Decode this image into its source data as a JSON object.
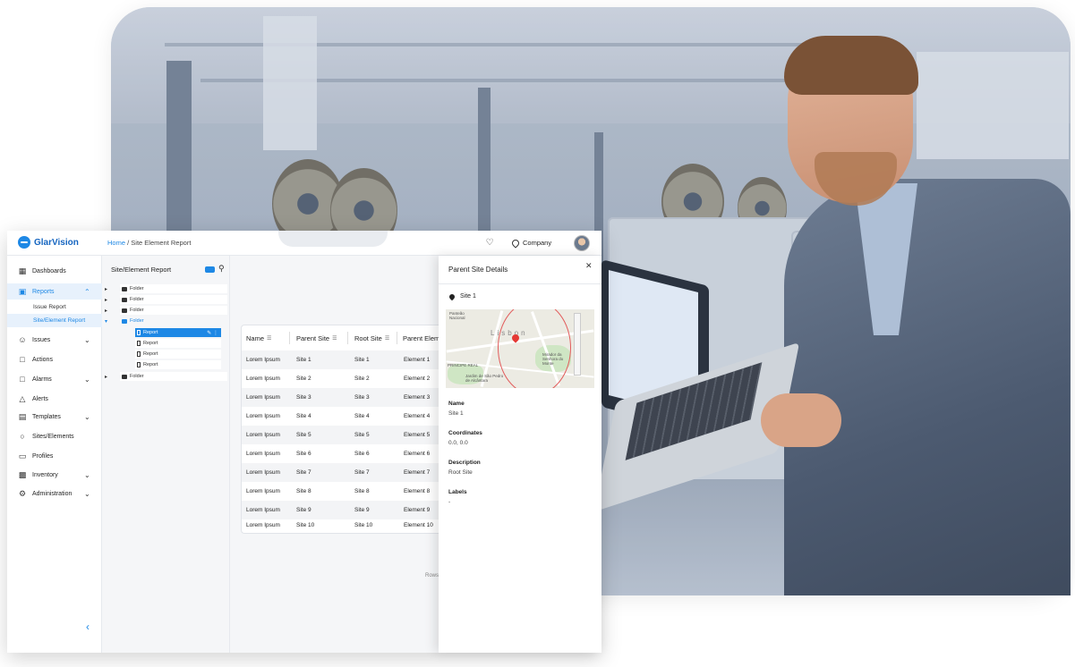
{
  "app": {
    "brand": "GlarVision",
    "breadcrumb_home": "Home",
    "breadcrumb_sep": " / ",
    "breadcrumb_current": "Site Element Report",
    "company": "Company"
  },
  "sidebar": {
    "items": [
      {
        "label": "Dashboards",
        "icon": "dashboard-icon"
      },
      {
        "label": "Reports",
        "icon": "report-icon",
        "active": true
      },
      {
        "label": "Issues",
        "icon": "issues-icon"
      },
      {
        "label": "Actions",
        "icon": "actions-icon"
      },
      {
        "label": "Alarms",
        "icon": "alarm-icon"
      },
      {
        "label": "Alerts",
        "icon": "alert-icon"
      },
      {
        "label": "Templates",
        "icon": "template-icon"
      },
      {
        "label": "Sites/Elements",
        "icon": "location-icon"
      },
      {
        "label": "Profiles",
        "icon": "profile-icon"
      },
      {
        "label": "Inventory",
        "icon": "inventory-icon"
      },
      {
        "label": "Administration",
        "icon": "gear-icon"
      }
    ],
    "sub_items": [
      "Issue Report",
      "Site/Element Report"
    ]
  },
  "tree": {
    "title": "Site/Element Report",
    "folder_label": "Folder",
    "report_label": "Report"
  },
  "table": {
    "headers": [
      "Name",
      "Parent Site",
      "Root Site",
      "Parent Elem"
    ],
    "rows": [
      [
        "Lorem Ipsum",
        "Site 1",
        "Site 1",
        "Element 1"
      ],
      [
        "Lorem Ipsum",
        "Site 2",
        "Site 2",
        "Element 2"
      ],
      [
        "Lorem Ipsum",
        "Site 3",
        "Site 3",
        "Element 3"
      ],
      [
        "Lorem Ipsum",
        "Site 4",
        "Site 4",
        "Element 4"
      ],
      [
        "Lorem Ipsum",
        "Site 5",
        "Site 5",
        "Element 5"
      ],
      [
        "Lorem Ipsum",
        "Site 6",
        "Site 6",
        "Element 6"
      ],
      [
        "Lorem Ipsum",
        "Site 7",
        "Site 7",
        "Element 7"
      ],
      [
        "Lorem Ipsum",
        "Site 8",
        "Site 8",
        "Element 8"
      ],
      [
        "Lorem Ipsum",
        "Site 9",
        "Site 9",
        "Element 9"
      ],
      [
        "Lorem Ipsum",
        "Site 10",
        "Site 10",
        "Element 10"
      ]
    ],
    "rows_label": "Rows"
  },
  "details": {
    "title": "Parent Site Details",
    "site": "Site 1",
    "map_city": "Lisbon",
    "map_labels": [
      "Panteão Nacional",
      "Mirador da Senhora do Monte",
      "Jardim de São Pedro de Alcântara",
      "PRINCIPE REAL"
    ],
    "fields": [
      {
        "label": "Name",
        "value": "Site 1"
      },
      {
        "label": "Coordinates",
        "value": "0.0, 0.0"
      },
      {
        "label": "Description",
        "value": "Root Site"
      },
      {
        "label": "Labels",
        "value": "-"
      }
    ]
  },
  "colors": {
    "accent": "#1e88e5",
    "active_bg": "#e7f1fc"
  }
}
